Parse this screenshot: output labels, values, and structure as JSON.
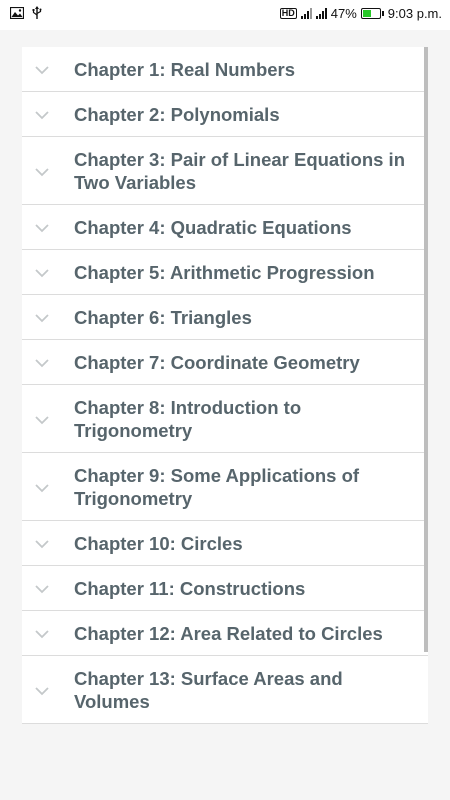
{
  "status_bar": {
    "left_icons": [
      "image-icon",
      "usb-icon"
    ],
    "hd_label": "HD",
    "battery_percent_text": "47%",
    "battery_level": 0.47,
    "time": "9:03 p.m."
  },
  "chapters": [
    {
      "label": "Chapter 1: Real Numbers"
    },
    {
      "label": "Chapter 2: Polynomials"
    },
    {
      "label": "Chapter 3: Pair of Linear Equations in Two Variables"
    },
    {
      "label": "Chapter 4: Quadratic Equations"
    },
    {
      "label": "Chapter 5: Arithmetic Progression"
    },
    {
      "label": "Chapter 6: Triangles"
    },
    {
      "label": "Chapter 7: Coordinate Geometry"
    },
    {
      "label": "Chapter 8: Introduction to Trigonometry"
    },
    {
      "label": "Chapter 9: Some Applications of Trigonometry"
    },
    {
      "label": "Chapter 10: Circles"
    },
    {
      "label": "Chapter 11: Constructions"
    },
    {
      "label": "Chapter 12: Area Related to Circles"
    },
    {
      "label": "Chapter 13: Surface Areas and Volumes"
    }
  ],
  "colors": {
    "label_text": "#57656c",
    "chevron": "#c4c8ca",
    "battery_fill": "#28c928"
  }
}
